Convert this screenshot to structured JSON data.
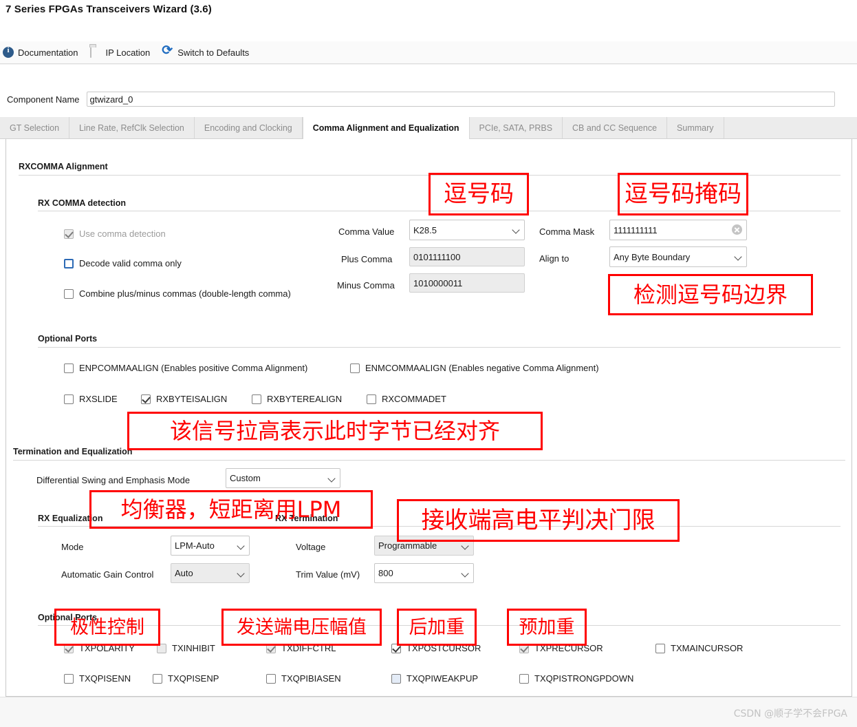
{
  "window": {
    "title": "7 Series FPGAs Transceivers Wizard (3.6)"
  },
  "toolbar": {
    "documentation": "Documentation",
    "ip_location": "IP Location",
    "switch_to_defaults": "Switch to Defaults",
    "icons": {
      "documentation": "info-icon",
      "ip_location": "folder-icon",
      "switch_to_defaults": "refresh-icon"
    }
  },
  "component": {
    "label": "Component Name",
    "value": "gtwizard_0",
    "placeholder": ""
  },
  "tabs": [
    {
      "label": "GT Selection",
      "active": false
    },
    {
      "label": "Line Rate, RefClk Selection",
      "active": false
    },
    {
      "label": "Encoding and Clocking",
      "active": false
    },
    {
      "label": "Comma Alignment and Equalization",
      "active": true
    },
    {
      "label": "PCIe, SATA, PRBS",
      "active": false
    },
    {
      "label": "CB and CC Sequence",
      "active": false
    },
    {
      "label": "Summary",
      "active": false
    }
  ],
  "rxcomma": {
    "group_title": "RXCOMMA Alignment",
    "detection_title": "RX COMMA detection",
    "checks": [
      {
        "label": "Use comma detection",
        "checked": true,
        "disabled": true,
        "focus": false
      },
      {
        "label": "Decode valid comma only",
        "checked": false,
        "disabled": false,
        "focus": true
      },
      {
        "label": "Combine plus/minus commas (double-length comma)",
        "checked": false,
        "disabled": false,
        "focus": false
      }
    ],
    "fields": {
      "comma_value_label": "Comma Value",
      "comma_value": "K28.5",
      "plus_comma_label": "Plus Comma",
      "plus_comma": "0101111100",
      "minus_comma_label": "Minus Comma",
      "minus_comma": "1010000011",
      "comma_mask_label": "Comma Mask",
      "comma_mask": "1111111111",
      "align_to_label": "Align to",
      "align_to": "Any Byte Boundary"
    },
    "optional_ports_title": "Optional Ports",
    "optional_ports_row1": [
      {
        "label": "ENPCOMMAALIGN (Enables positive Comma Alignment)",
        "checked": false
      },
      {
        "label": "ENMCOMMAALIGN (Enables negative Comma Alignment)",
        "checked": false
      }
    ],
    "optional_ports_row2": [
      {
        "label": "RXSLIDE",
        "checked": false
      },
      {
        "label": "RXBYTEISALIGN",
        "checked": true
      },
      {
        "label": "RXBYTEREALIGN",
        "checked": false
      },
      {
        "label": "RXCOMMADET",
        "checked": false
      }
    ]
  },
  "termination": {
    "group_title": "Termination and Equalization",
    "swing_label": "Differential Swing and Emphasis Mode",
    "swing_value": "Custom",
    "rx_equalization_title": "RX Equalization",
    "rx_termination_title": "RX Termination",
    "mode_label": "Mode",
    "mode_value": "LPM-Auto",
    "agc_label": "Automatic Gain Control",
    "agc_value": "Auto",
    "voltage_label": "Voltage",
    "voltage_value": "Programmable",
    "trim_label": "Trim Value (mV)",
    "trim_value": "800",
    "optional_ports_title": "Optional Ports",
    "optional_ports_row1": [
      {
        "label": "TXPOLARITY",
        "checked": true,
        "disabled": true
      },
      {
        "label": "TXINHIBIT",
        "checked": false,
        "disabled": true
      },
      {
        "label": "TXDIFFCTRL",
        "checked": true,
        "disabled": true
      },
      {
        "label": "TXPOSTCURSOR",
        "checked": true,
        "disabled": false
      },
      {
        "label": "TXPRECURSOR",
        "checked": true,
        "disabled": true
      },
      {
        "label": "TXMAINCURSOR",
        "checked": false,
        "disabled": false
      }
    ],
    "optional_ports_row2": [
      {
        "label": "TXQPISENN",
        "checked": false,
        "hover": false
      },
      {
        "label": "TXQPISENP",
        "checked": false,
        "hover": false
      },
      {
        "label": "TXQPIBIASEN",
        "checked": false,
        "hover": false
      },
      {
        "label": "TXQPIWEAKPUP",
        "checked": false,
        "hover": true
      },
      {
        "label": "TXQPISTRONGPDOWN",
        "checked": false,
        "hover": false
      }
    ]
  },
  "annotations": [
    {
      "id": "comma-code",
      "text": "逗号码"
    },
    {
      "id": "comma-code-mask",
      "text": "逗号码掩码"
    },
    {
      "id": "detect-boundary",
      "text": "检测逗号码边界"
    },
    {
      "id": "signal-high-aligned",
      "text": "该信号拉高表示此时字节已经对齐"
    },
    {
      "id": "equalizer-lpm",
      "text": "均衡器，短距离用LPM"
    },
    {
      "id": "rx-threshold",
      "text": "接收端高电平判决门限"
    },
    {
      "id": "polarity-control",
      "text": "极性控制"
    },
    {
      "id": "tx-swing",
      "text": "发送端电压幅值"
    },
    {
      "id": "post-emphasis",
      "text": "后加重"
    },
    {
      "id": "pre-emphasis",
      "text": "预加重"
    }
  ],
  "footer": {
    "watermark": "CSDN @顺子学不会FPGA"
  },
  "colors": {
    "annotation": "#ff0000",
    "accent": "#2c6ab5",
    "tab_active_bg": "#ffffff",
    "tab_bg": "#ececec"
  }
}
